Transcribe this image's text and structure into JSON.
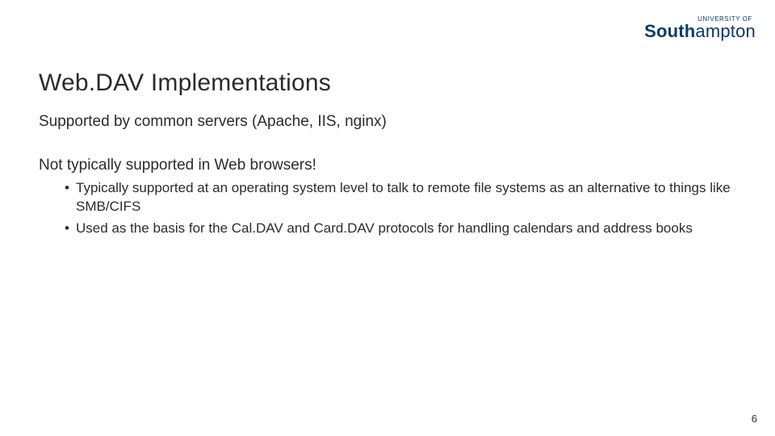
{
  "logo": {
    "overline": "UNIVERSITY OF",
    "word_bold": "South",
    "word_rest": "ampton"
  },
  "title": "Web.DAV Implementations",
  "paragraphs": [
    "Supported by common servers (Apache, IIS, nginx)",
    "Not typically supported in Web browsers!"
  ],
  "bullets": [
    "Typically supported at an operating system level to talk to remote file systems as an alternative to things like SMB/CIFS",
    "Used as the basis for the Cal.DAV and Card.DAV protocols for handling calendars and address books"
  ],
  "page_number": "6"
}
